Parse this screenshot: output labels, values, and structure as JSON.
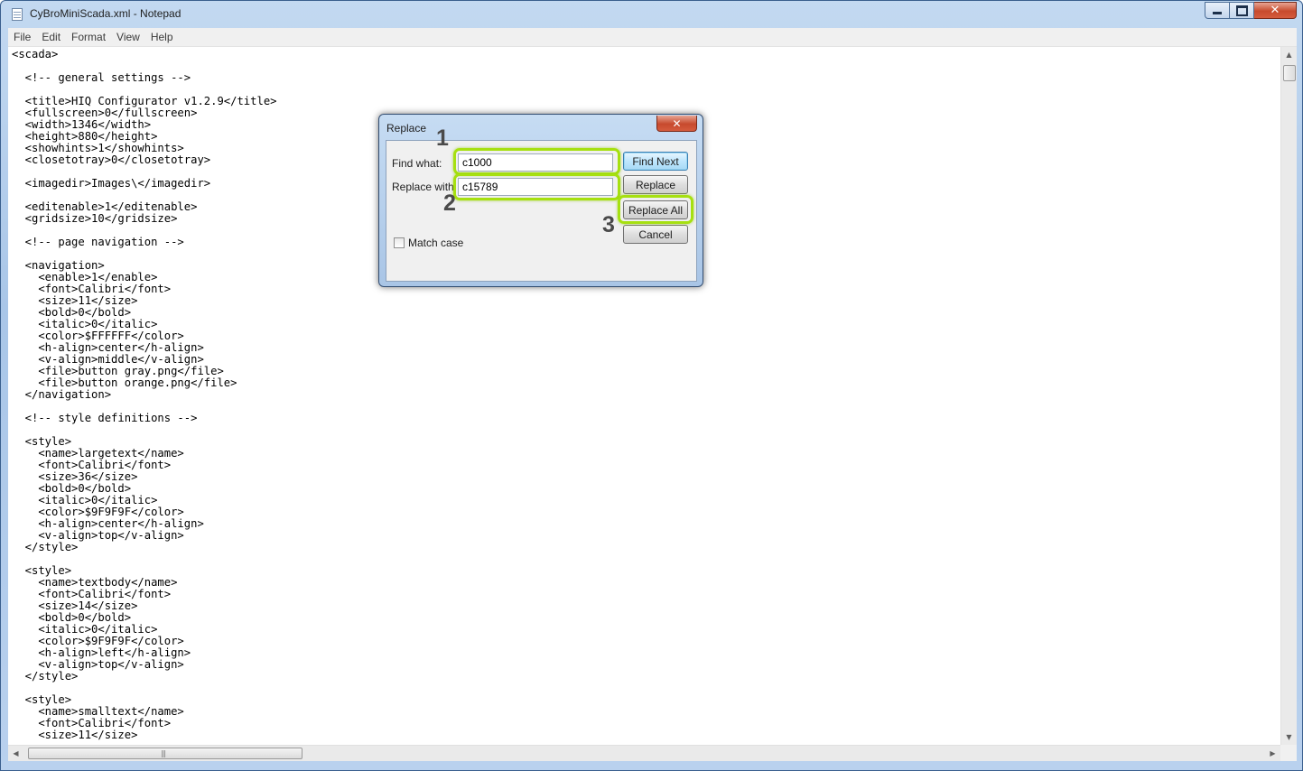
{
  "window": {
    "title": "CyBroMiniScada.xml - Notepad",
    "icon": "notepad-icon",
    "controls": {
      "minimize": "minimize-icon",
      "maximize": "maximize-icon",
      "close": "✕"
    }
  },
  "menu": [
    "File",
    "Edit",
    "Format",
    "View",
    "Help"
  ],
  "editor": {
    "content": "<scada>\n\n  <!-- general settings -->\n\n  <title>HIQ Configurator v1.2.9</title>\n  <fullscreen>0</fullscreen>\n  <width>1346</width>\n  <height>880</height>\n  <showhints>1</showhints>\n  <closetotray>0</closetotray>\n\n  <imagedir>Images\\</imagedir>\n\n  <editenable>1</editenable>\n  <gridsize>10</gridsize>\n\n  <!-- page navigation -->\n\n  <navigation>\n    <enable>1</enable>\n    <font>Calibri</font>\n    <size>11</size>\n    <bold>0</bold>\n    <italic>0</italic>\n    <color>$FFFFFF</color>\n    <h-align>center</h-align>\n    <v-align>middle</v-align>\n    <file>button gray.png</file>\n    <file>button orange.png</file>\n  </navigation>\n\n  <!-- style definitions -->\n\n  <style>\n    <name>largetext</name>\n    <font>Calibri</font>\n    <size>36</size>\n    <bold>0</bold>\n    <italic>0</italic>\n    <color>$9F9F9F</color>\n    <h-align>center</h-align>\n    <v-align>top</v-align>\n  </style>\n\n  <style>\n    <name>textbody</name>\n    <font>Calibri</font>\n    <size>14</size>\n    <bold>0</bold>\n    <italic>0</italic>\n    <color>$9F9F9F</color>\n    <h-align>left</h-align>\n    <v-align>top</v-align>\n  </style>\n\n  <style>\n    <name>smalltext</name>\n    <font>Calibri</font>\n    <size>11</size>"
  },
  "scrollbars": {
    "up": "▲",
    "down": "▼",
    "left": "◀",
    "right": "▶",
    "grip": "|||"
  },
  "dialog": {
    "title": "Replace",
    "close": "✕",
    "find_label": "Find what:",
    "find_value": "c1000",
    "replace_label": "Replace with:",
    "replace_value": "c15789",
    "match_case_label": "Match case",
    "match_case_checked": false,
    "buttons": {
      "find_next": "Find Next",
      "replace": "Replace",
      "replace_all": "Replace All",
      "cancel": "Cancel"
    }
  },
  "annotations": {
    "step1": "1",
    "step2": "2",
    "step3": "3",
    "highlight_color": "#a6e010"
  }
}
